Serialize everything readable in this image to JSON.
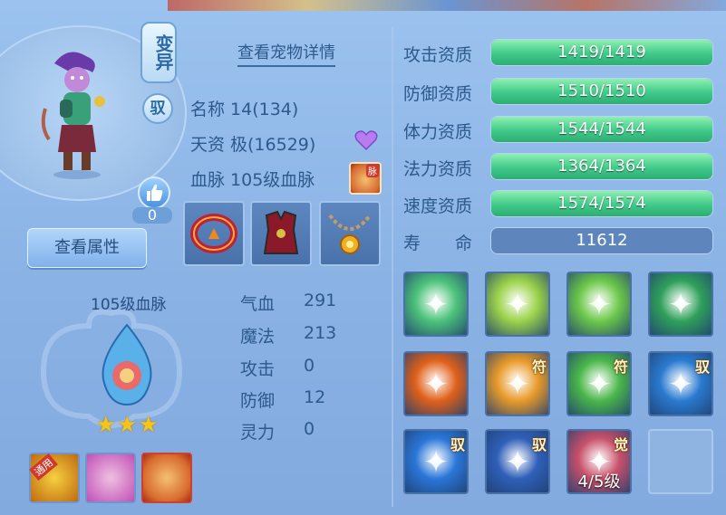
{
  "pet": {
    "badge_variant": "变异",
    "badge_mount": "驭",
    "like_count": "0",
    "view_details": "查看宠物详情",
    "view_attributes": "查看属性",
    "name_label": "名称",
    "name_value": "14(134)",
    "talent_label": "天资",
    "talent_value": "极(16529)",
    "bloodline_label": "血脉",
    "bloodline_value": "105级血脉",
    "bloodline_icon_tag": "脉"
  },
  "bloodline_panel": {
    "title": "105级血脉",
    "stars": "★★★"
  },
  "small_skills": [
    {
      "tag": "通用",
      "color": "#e8a020"
    },
    {
      "tag": "",
      "color": "#d070c8"
    },
    {
      "tag": "",
      "color": "#e07a40"
    }
  ],
  "stats": [
    {
      "label": "气血",
      "value": "291"
    },
    {
      "label": "魔法",
      "value": "213"
    },
    {
      "label": "攻击",
      "value": "0"
    },
    {
      "label": "防御",
      "value": "12"
    },
    {
      "label": "灵力",
      "value": "0"
    }
  ],
  "aptitudes": [
    {
      "label": "攻击资质",
      "value": "1419/1419",
      "fill": 1.0
    },
    {
      "label": "防御资质",
      "value": "1510/1510",
      "fill": 1.0
    },
    {
      "label": "体力资质",
      "value": "1544/1544",
      "fill": 1.0
    },
    {
      "label": "法力资质",
      "value": "1364/1364",
      "fill": 1.0
    },
    {
      "label": "速度资质",
      "value": "1574/1574",
      "fill": 1.0
    }
  ],
  "life": {
    "label_a": "寿",
    "label_b": "命",
    "value": "11612"
  },
  "skills": [
    {
      "name": "heart-wings-skill-icon",
      "tag": "",
      "level": "",
      "color": "#4cc27a"
    },
    {
      "name": "shield-badge-skill-icon",
      "tag": "",
      "level": "",
      "color": "#9ad24a"
    },
    {
      "name": "boot-skill-icon",
      "tag": "",
      "level": "",
      "color": "#6cc84a"
    },
    {
      "name": "rider-skill-icon",
      "tag": "",
      "level": "",
      "color": "#2fa05a"
    },
    {
      "name": "fire-orb-skill-icon",
      "tag": "",
      "level": "",
      "color": "#e0601a"
    },
    {
      "name": "lightning-hand-skill-icon",
      "tag": "符",
      "level": "",
      "color": "#e89a2a"
    },
    {
      "name": "figure-skill-icon",
      "tag": "符",
      "level": "",
      "color": "#4ab64a"
    },
    {
      "name": "water-beast-skill-icon",
      "tag": "驭",
      "level": "",
      "color": "#2a7ad0"
    },
    {
      "name": "shield-skill-icon",
      "tag": "驭",
      "level": "",
      "color": "#2a76d8"
    },
    {
      "name": "armor-skill-icon",
      "tag": "驭",
      "level": "",
      "color": "#2f5fb8"
    },
    {
      "name": "awaken-skill-icon",
      "tag": "觉",
      "level": "4/5级",
      "color": "#c8506a"
    },
    {
      "name": "empty-skill-slot",
      "tag": "",
      "level": "",
      "color": "#8fb4e2"
    }
  ]
}
